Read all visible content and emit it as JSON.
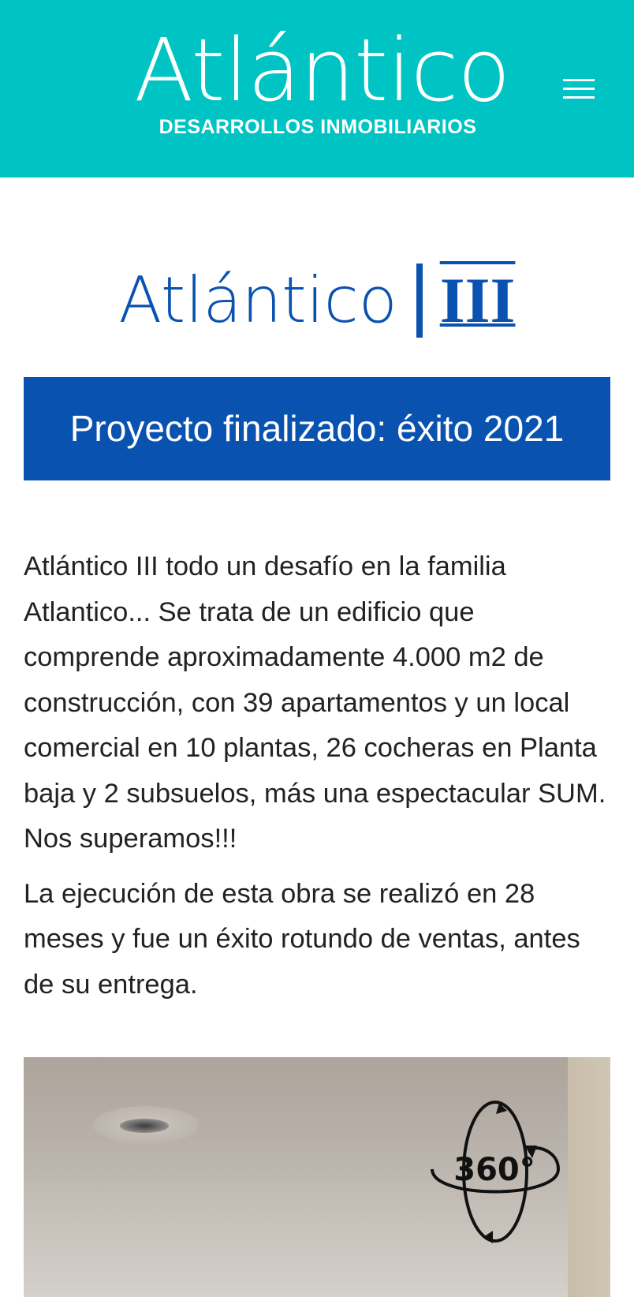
{
  "header": {
    "brand_name": "Atlántico",
    "brand_tagline": "DESARROLLOS INMOBILIARIOS",
    "menu_icon": "hamburger-menu-icon",
    "background_color": "#00c4c4"
  },
  "project": {
    "name": "Atlántico",
    "numeral": "III",
    "title_color": "#0a52b0"
  },
  "banner": {
    "text": "Proyecto finalizado: éxito 2021",
    "background_color": "#0a52b0"
  },
  "description": {
    "paragraphs": [
      "Atlántico III todo un desafío en la familia Atlantico... Se trata de un edificio que comprende aproximadamente 4.000 m2 de construcción, con 39 apartamentos y un local comercial en 10 plantas, 26 cocheras en Planta baja y 2 subsuelos, más una espectacular SUM. Nos superamos!!!",
      "La ejecución de esta obra se realizó en 28 meses y fue un éxito rotundo de ventas, antes de su entrega."
    ]
  },
  "tour": {
    "badge_text": "360°",
    "badge_icon": "360-view-icon"
  }
}
